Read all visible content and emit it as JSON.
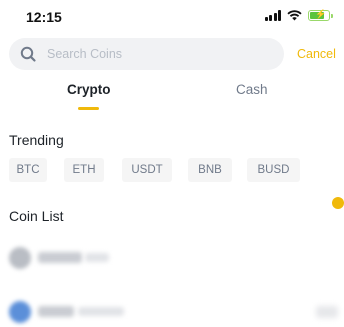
{
  "status_bar": {
    "time": "12:15",
    "icons": [
      "signal-icon",
      "wifi-icon",
      "battery-charging-icon"
    ]
  },
  "search": {
    "placeholder": "Search Coins",
    "value": "",
    "cancel_label": "Cancel",
    "icon": "search-icon"
  },
  "tabs": [
    {
      "label": "Crypto",
      "active": true
    },
    {
      "label": "Cash",
      "active": false
    }
  ],
  "trending": {
    "title": "Trending",
    "chips": [
      "BTC",
      "ETH",
      "USDT",
      "BNB",
      "BUSD"
    ]
  },
  "coin_list": {
    "title": "Coin List"
  },
  "colors": {
    "accent": "#f0b90b",
    "text_primary": "#1e2329",
    "text_secondary": "#707a8a",
    "placeholder": "#b7bdc6",
    "search_bg": "#f1f2f4",
    "chip_bg": "#f5f5f5"
  }
}
